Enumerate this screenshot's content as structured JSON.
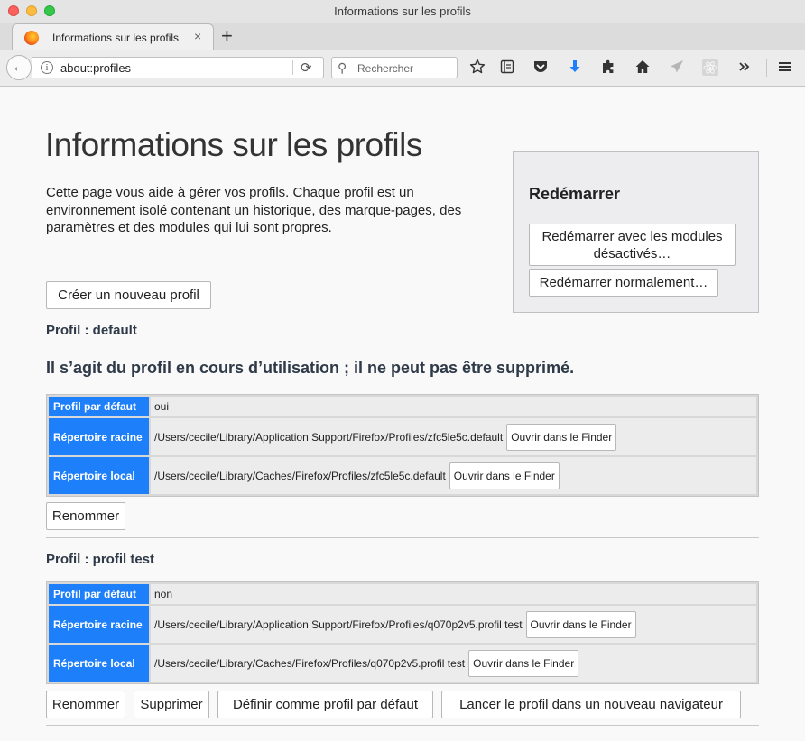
{
  "window": {
    "title": "Informations sur les profils"
  },
  "tab": {
    "label": "Informations sur les profils",
    "close": "×",
    "new_tab": "+"
  },
  "navbar": {
    "back": "←",
    "info": "i",
    "url": "about:profiles",
    "reload": "⟳",
    "search_icon": "⚲",
    "search_placeholder": "Rechercher",
    "toolbar_icons": [
      "star-icon",
      "reader-list-icon",
      "pocket-icon",
      "downloads-icon",
      "extensions-icon",
      "home-icon",
      "send-icon",
      "react-devtools-icon",
      "overflow-icon",
      "menu-icon"
    ]
  },
  "page": {
    "title": "Informations sur les profils",
    "intro": "Cette page vous aide à gérer vos profils. Chaque profil est un environnement isolé contenant un historique, des marque-pages, des paramètres et des modules qui lui sont propres.",
    "create_button": "Créer un nouveau profil",
    "restart": {
      "title": "Redémarrer",
      "safe_mode_button": "Redémarrer avec les modules désactivés…",
      "normal_button": "Redémarrer normalement…"
    }
  },
  "profiles": [
    {
      "heading": "Profil : default",
      "in_use_message": "Il s’agit du profil en cours d’utilisation ; il ne peut pas être supprimé.",
      "rows": {
        "default_label": "Profil par défaut",
        "default_value": "oui",
        "root_label": "Répertoire racine",
        "root_value": "/Users/cecile/Library/Application Support/Firefox/Profiles/zfc5le5c.default",
        "local_label": "Répertoire local",
        "local_value": "/Users/cecile/Library/Caches/Firefox/Profiles/zfc5le5c.default",
        "open_button": "Ouvrir dans le Finder"
      },
      "buttons": {
        "rename": "Renommer"
      }
    },
    {
      "heading": "Profil : profil test",
      "rows": {
        "default_label": "Profil par défaut",
        "default_value": "non",
        "root_label": "Répertoire racine",
        "root_value": "/Users/cecile/Library/Application Support/Firefox/Profiles/q070p2v5.profil test",
        "local_label": "Répertoire local",
        "local_value": "/Users/cecile/Library/Caches/Firefox/Profiles/q070p2v5.profil test",
        "open_button": "Ouvrir dans le Finder"
      },
      "buttons": {
        "rename": "Renommer",
        "delete": "Supprimer",
        "set_default": "Définir comme profil par défaut",
        "launch": "Lancer le profil dans un nouveau navigateur"
      }
    }
  ],
  "colors": {
    "accent": "#1e7ffa",
    "heading": "#2f3a48",
    "downloads": "#1e7ffa"
  }
}
